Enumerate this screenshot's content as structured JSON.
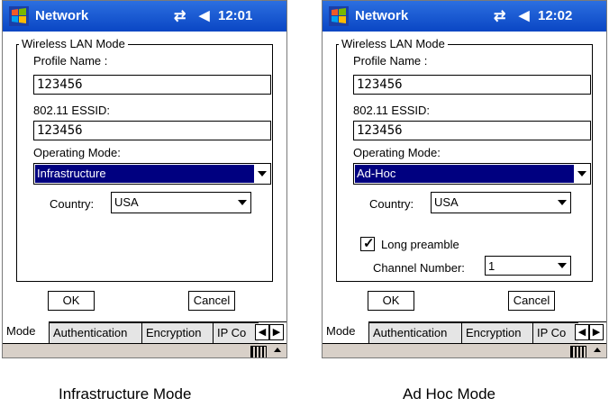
{
  "screens": [
    {
      "title": "Network",
      "time": "12:01",
      "signal_icon": "connectivity-icon",
      "volume_icon": "speaker-icon",
      "group_title": "Wireless LAN Mode",
      "profile_name_label": "Profile Name :",
      "profile_name_value": "123456",
      "essid_label": "802.11 ESSID:",
      "essid_value": "123456",
      "operating_mode_label": "Operating Mode:",
      "operating_mode_value": "Infrastructure",
      "country_label": "Country:",
      "country_value": "USA",
      "ok_label": "OK",
      "cancel_label": "Cancel",
      "tabs": [
        "Mode",
        "Authentication",
        "Encryption",
        "IP Co"
      ],
      "caption": "Infrastructure Mode"
    },
    {
      "title": "Network",
      "time": "12:02",
      "signal_icon": "connectivity-icon",
      "volume_icon": "speaker-icon",
      "group_title": "Wireless LAN Mode",
      "profile_name_label": "Profile Name :",
      "profile_name_value": "123456",
      "essid_label": "802.11 ESSID:",
      "essid_value": "123456",
      "operating_mode_label": "Operating Mode:",
      "operating_mode_value": "Ad-Hoc",
      "country_label": "Country:",
      "country_value": "USA",
      "long_preamble_label": "Long preamble",
      "long_preamble_checked": true,
      "channel_label": "Channel Number:",
      "channel_value": "1",
      "ok_label": "OK",
      "cancel_label": "Cancel",
      "tabs": [
        "Mode",
        "Authentication",
        "Encryption",
        "IP Co"
      ],
      "caption": "Ad Hoc Mode"
    }
  ],
  "colors": {
    "titlebar": "#0a46c4",
    "selection": "#000080",
    "bottom_bar": "#d8d0c8"
  }
}
